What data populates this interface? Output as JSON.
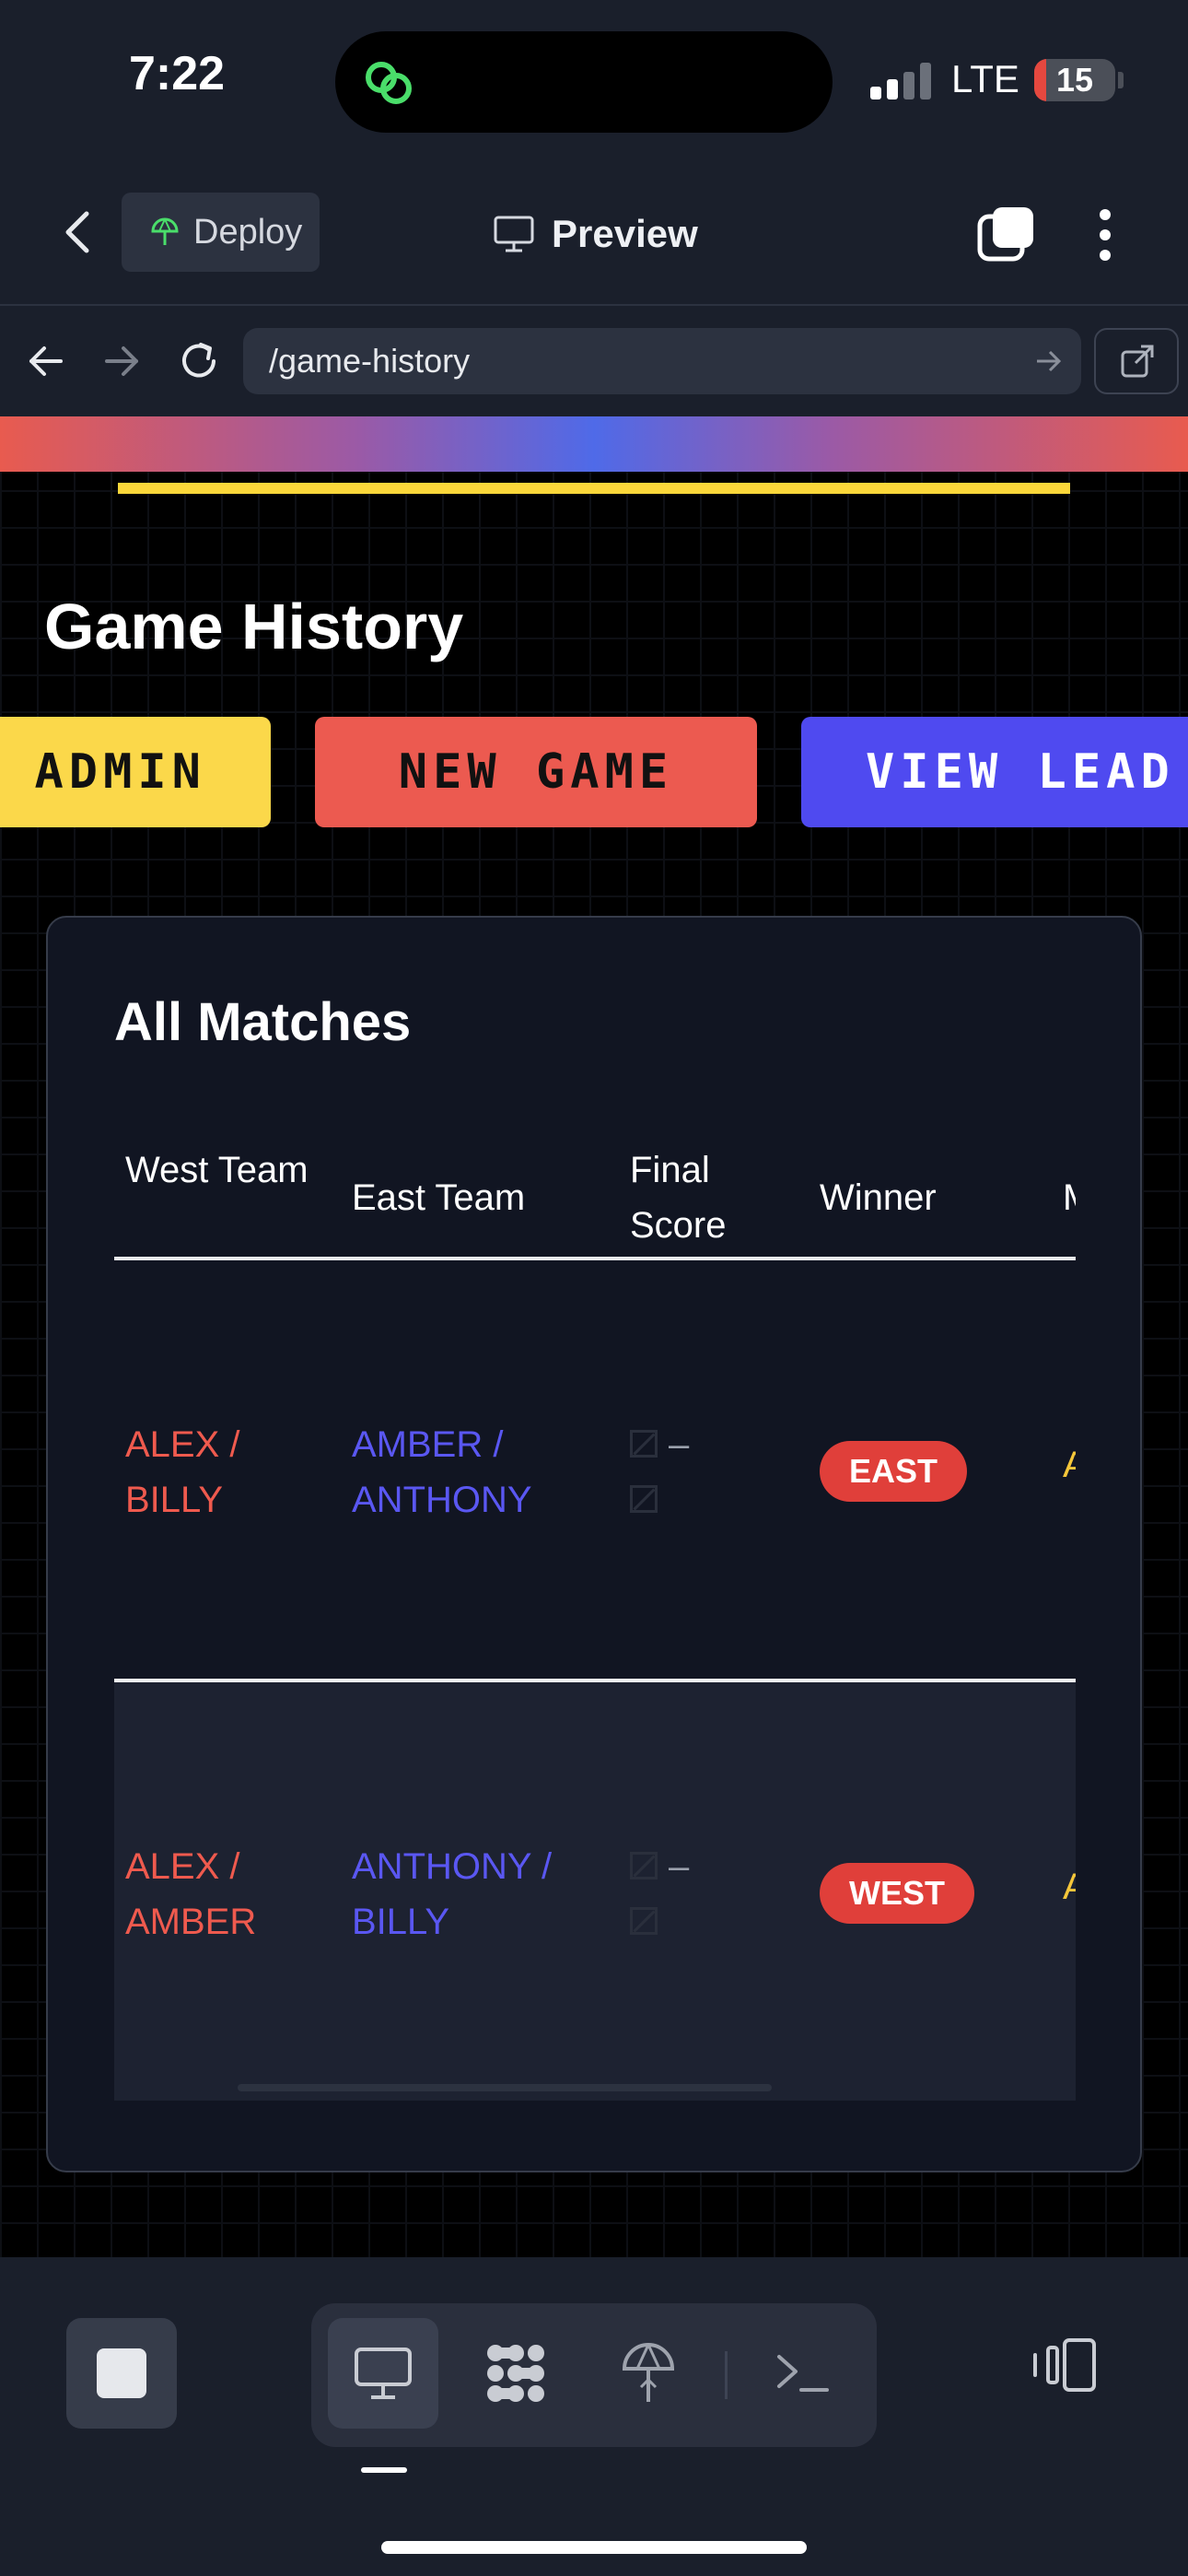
{
  "status": {
    "time": "7:22",
    "network": "LTE",
    "battery": "15",
    "battery_level": 0.15
  },
  "header": {
    "deploy_label": "Deploy",
    "preview_label": "Preview"
  },
  "browser": {
    "url": "/game-history"
  },
  "page": {
    "title": "Game History",
    "buttons": {
      "admin": "ADMIN",
      "new_game": "NEW GAME",
      "view_leaderboard": "VIEW LEAD"
    }
  },
  "matches": {
    "title": "All Matches",
    "columns": {
      "west": "West Team",
      "east": "East Team",
      "score": "Final Score",
      "winner": "Winner",
      "extra": "M"
    },
    "rows": [
      {
        "west": "ALEX / BILLY",
        "east": "AMBER / ANTHONY",
        "score_sep": "–",
        "winner": "EAST",
        "extra": "A"
      },
      {
        "west": "ALEX / AMBER",
        "east": "ANTHONY / BILLY",
        "score_sep": "–",
        "winner": "WEST",
        "extra": "A"
      }
    ]
  },
  "colors": {
    "accent_yellow": "#fbd84a",
    "accent_red": "#ec5a50",
    "accent_blue": "#4f4af0",
    "west_team": "#ef5a4e",
    "east_team": "#5a57f2"
  },
  "icons": {
    "island": "link-chain-icon",
    "deploy": "deploy-icon",
    "preview": "monitor-icon",
    "toolbar": [
      "monitor-icon",
      "modules-icon",
      "deploy-icon",
      "terminal-icon"
    ]
  }
}
